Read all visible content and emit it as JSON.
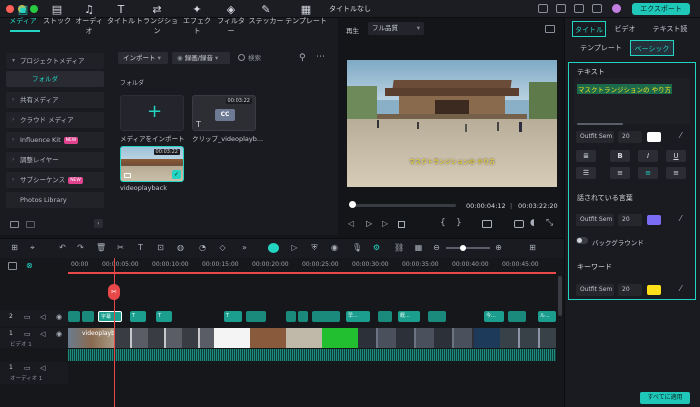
{
  "app": {
    "title": "タイトルなし",
    "export_label": "エクスポート"
  },
  "media_tabs": [
    {
      "label": "メディア",
      "icon": "▣"
    },
    {
      "label": "ストック",
      "icon": "▤"
    },
    {
      "label": "オーディオ",
      "icon": "♫"
    },
    {
      "label": "タイトル",
      "icon": "T"
    },
    {
      "label": "トランジション",
      "icon": "⇄"
    },
    {
      "label": "エフェクト",
      "icon": "✦"
    },
    {
      "label": "フィルター",
      "icon": "◈"
    },
    {
      "label": "ステッカー",
      "icon": "✎"
    },
    {
      "label": "テンプレート",
      "icon": "▦"
    }
  ],
  "sidebar": {
    "project_media": "プロジェクトメディア",
    "folder": "フォルダ",
    "items": [
      {
        "label": "共有メディア",
        "badge": ""
      },
      {
        "label": "クラウド メディア",
        "badge": ""
      },
      {
        "label": "Influence Kit",
        "badge": "NEW"
      },
      {
        "label": "調整レイヤー",
        "badge": ""
      },
      {
        "label": "サブシーケンス",
        "badge": "NEW"
      },
      {
        "label": "Photos Library",
        "badge": ""
      }
    ]
  },
  "media_toolbar": {
    "import_label": "インポート",
    "record_label": "録画/録音",
    "search_placeholder": "検索"
  },
  "media_grid": {
    "folder_label": "フォルダ",
    "items": [
      {
        "label": "メディアをインポート",
        "duration": ""
      },
      {
        "label": "クリップ_videoplayb...",
        "duration": "00:03:22"
      },
      {
        "label": "videoplayback",
        "duration": "00:03:22"
      }
    ]
  },
  "preview": {
    "play_label": "再生",
    "quality": "フル品質",
    "subtitle": "マスクトランジションの やり方",
    "current_time": "00:00:04:12",
    "total_time": "00:03:22:20",
    "progress": 0.02
  },
  "right_panel": {
    "tabs": [
      "タイトル",
      "ビデオ",
      "テキスト読"
    ],
    "subtabs": [
      "テンプレート",
      "ベーシック"
    ],
    "text_section": "テキスト",
    "text_value": "マスクトランジションの やり方",
    "font": "Outfit Sem",
    "size": "20",
    "spoken_section": "話されている言葉",
    "spoken_font": "Outfit Sem",
    "spoken_size": "20",
    "background_label": "バックグラウンド",
    "keyword_section": "キーワード",
    "keyword_font": "Outfit Sem",
    "keyword_size": "20",
    "apply_all": "すべてに適用",
    "colors": {
      "text": "#ffffff",
      "spoken": "#7b6cf6",
      "keyword": "#ffe01a",
      "accent": "#23d4c3"
    }
  },
  "timeline": {
    "ruler": [
      "00:00",
      "00:00:05:00",
      "00:00:10:00",
      "00:00:15:00",
      "00:00:20:00",
      "00:00:25:00",
      "00:00:30:00",
      "00:00:35:00",
      "00:00:40:00",
      "00:00:45:00"
    ],
    "tracks": [
      {
        "label": "ビデオ 1"
      },
      {
        "label": "オーディオ 1"
      }
    ],
    "track_nums": [
      "2",
      "1",
      "1"
    ],
    "video_clip_label": "videoplayback",
    "title_clips": [
      "字幕",
      "T",
      "T",
      "T",
      "早...",
      "T",
      "概...",
      "今...",
      "T",
      "ル..."
    ]
  }
}
